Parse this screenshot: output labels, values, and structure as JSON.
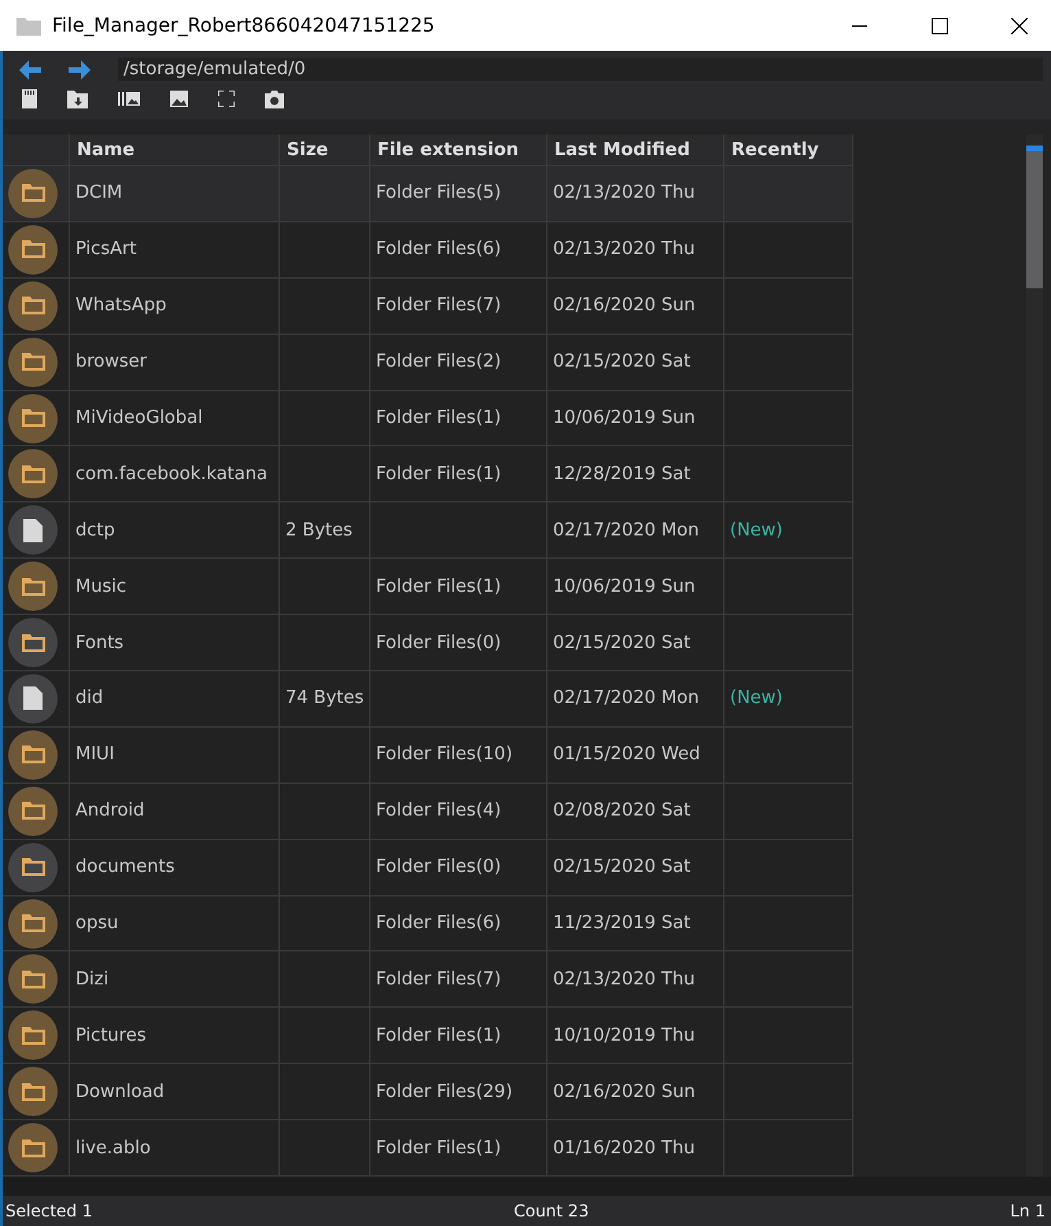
{
  "window": {
    "title": "File_Manager_Robert866042047151225"
  },
  "path": "/storage/emulated/0",
  "table": {
    "columns": [
      "Name",
      "Size",
      "File extension",
      "Last Modified",
      "Recently"
    ],
    "rows": [
      {
        "kind": "folder",
        "name": "DCIM",
        "size": "",
        "extension": "Folder Files(5)",
        "modified": "02/13/2020 Thu",
        "recently": "",
        "selected": true
      },
      {
        "kind": "folder",
        "name": "PicsArt",
        "size": "",
        "extension": "Folder Files(6)",
        "modified": "02/13/2020 Thu",
        "recently": "",
        "selected": false
      },
      {
        "kind": "folder",
        "name": "WhatsApp",
        "size": "",
        "extension": "Folder Files(7)",
        "modified": "02/16/2020 Sun",
        "recently": "",
        "selected": false
      },
      {
        "kind": "folder",
        "name": "browser",
        "size": "",
        "extension": "Folder Files(2)",
        "modified": "02/15/2020 Sat",
        "recently": "",
        "selected": false
      },
      {
        "kind": "folder",
        "name": "MiVideoGlobal",
        "size": "",
        "extension": "Folder Files(1)",
        "modified": "10/06/2019 Sun",
        "recently": "",
        "selected": false
      },
      {
        "kind": "folder",
        "name": "com.facebook.katana",
        "size": "",
        "extension": "Folder Files(1)",
        "modified": "12/28/2019 Sat",
        "recently": "",
        "selected": false
      },
      {
        "kind": "file",
        "name": "dctp",
        "size": "2 Bytes",
        "extension": "",
        "modified": "02/17/2020 Mon",
        "recently": "(New)",
        "selected": false
      },
      {
        "kind": "folder",
        "name": "Music",
        "size": "",
        "extension": "Folder Files(1)",
        "modified": "10/06/2019 Sun",
        "recently": "",
        "selected": false
      },
      {
        "kind": "empty-folder",
        "name": "Fonts",
        "size": "",
        "extension": "Folder Files(0)",
        "modified": "02/15/2020 Sat",
        "recently": "",
        "selected": false
      },
      {
        "kind": "file",
        "name": "did",
        "size": "74 Bytes",
        "extension": "",
        "modified": "02/17/2020 Mon",
        "recently": "(New)",
        "selected": false
      },
      {
        "kind": "folder",
        "name": "MIUI",
        "size": "",
        "extension": "Folder Files(10)",
        "modified": "01/15/2020 Wed",
        "recently": "",
        "selected": false
      },
      {
        "kind": "folder",
        "name": "Android",
        "size": "",
        "extension": "Folder Files(4)",
        "modified": "02/08/2020 Sat",
        "recently": "",
        "selected": false
      },
      {
        "kind": "empty-folder",
        "name": "documents",
        "size": "",
        "extension": "Folder Files(0)",
        "modified": "02/15/2020 Sat",
        "recently": "",
        "selected": false
      },
      {
        "kind": "folder",
        "name": "opsu",
        "size": "",
        "extension": "Folder Files(6)",
        "modified": "11/23/2019 Sat",
        "recently": "",
        "selected": false
      },
      {
        "kind": "folder",
        "name": "Dizi",
        "size": "",
        "extension": "Folder Files(7)",
        "modified": "02/13/2020 Thu",
        "recently": "",
        "selected": false
      },
      {
        "kind": "folder",
        "name": "Pictures",
        "size": "",
        "extension": "Folder Files(1)",
        "modified": "10/10/2019 Thu",
        "recently": "",
        "selected": false
      },
      {
        "kind": "folder",
        "name": "Download",
        "size": "",
        "extension": "Folder Files(29)",
        "modified": "02/16/2020 Sun",
        "recently": "",
        "selected": false
      },
      {
        "kind": "folder",
        "name": "live.ablo",
        "size": "",
        "extension": "Folder Files(1)",
        "modified": "01/16/2020 Thu",
        "recently": "",
        "selected": false
      }
    ]
  },
  "status_bar": {
    "selected": "Selected 1",
    "count": "Count 23",
    "line": "Ln 1"
  }
}
